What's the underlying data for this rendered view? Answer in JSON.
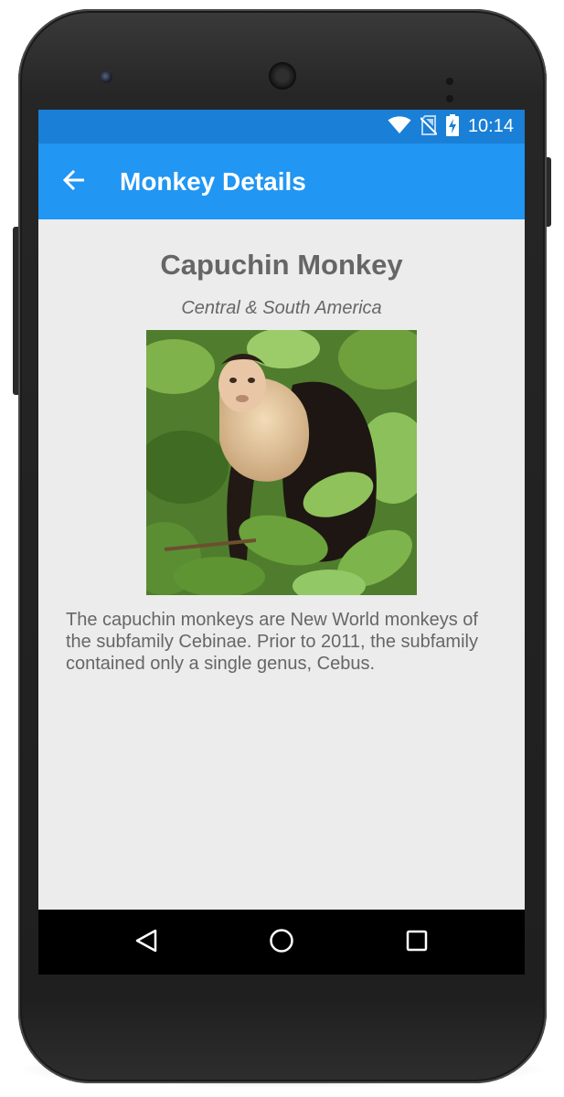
{
  "status_bar": {
    "time": "10:14",
    "icons": [
      "wifi-icon",
      "no-sim-icon",
      "battery-charging-icon"
    ]
  },
  "toolbar": {
    "back_icon": "arrow-left-icon",
    "title": "Monkey Details"
  },
  "monkey": {
    "name": "Capuchin Monkey",
    "location": "Central & South America",
    "details": "The capuchin monkeys are New World monkeys of the subfamily Cebinae. Prior to 2011, the subfamily contained only a single genus, Cebus."
  },
  "nav_bar": {
    "icons": [
      "back-triangle-icon",
      "home-circle-icon",
      "recents-square-icon"
    ]
  },
  "colors": {
    "status_bar": "#1a7fd6",
    "toolbar": "#2196f3",
    "background": "#ececec",
    "text": "#666666"
  }
}
